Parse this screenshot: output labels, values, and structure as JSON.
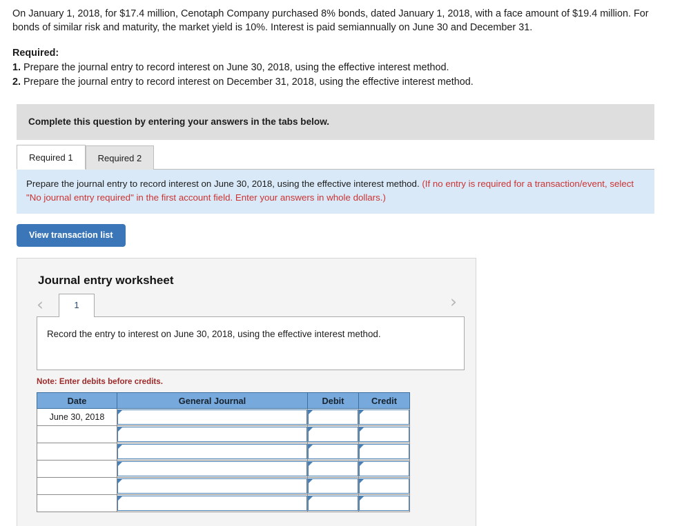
{
  "problem": {
    "text": "On January 1, 2018, for $17.4 million, Cenotaph Company purchased 8% bonds, dated January 1, 2018, with a face amount of $19.4 million. For bonds of similar risk and maturity, the market yield is 10%. Interest is paid semiannually on June 30 and December 31."
  },
  "required": {
    "title": "Required:",
    "items": [
      {
        "num": "1.",
        "text": "Prepare the journal entry to record interest on June 30, 2018, using the effective interest method."
      },
      {
        "num": "2.",
        "text": "Prepare the journal entry to record interest on December 31, 2018, using the effective interest method."
      }
    ]
  },
  "banner": {
    "text": "Complete this question by entering your answers in the tabs below."
  },
  "tabs": [
    {
      "label": "Required 1",
      "active": true
    },
    {
      "label": "Required 2",
      "active": false
    }
  ],
  "instruction": {
    "plain": "Prepare the journal entry to record interest on June 30, 2018, using the effective interest method.",
    "hint": "(If no entry is required for a transaction/event, select \"No journal entry required\" in the first account field. Enter your answers in whole dollars.)"
  },
  "toolbar": {
    "view_transaction_list_label": "View transaction list",
    "button_color": "#3a76b8"
  },
  "worksheet": {
    "title": "Journal entry worksheet",
    "pager": {
      "prev_icon": "chevron-left-icon",
      "next_icon": "chevron-right-icon",
      "pages": [
        "1"
      ],
      "active_page": "1"
    },
    "description": "Record the entry to interest on June 30, 2018, using the effective interest method.",
    "note": "Note: Enter debits before credits.",
    "table": {
      "header_color": "#78a9dd",
      "columns": [
        "Date",
        "General Journal",
        "Debit",
        "Credit"
      ],
      "rows": [
        {
          "date": "June 30, 2018",
          "general_journal": "",
          "debit": "",
          "credit": ""
        },
        {
          "date": "",
          "general_journal": "",
          "debit": "",
          "credit": ""
        },
        {
          "date": "",
          "general_journal": "",
          "debit": "",
          "credit": ""
        },
        {
          "date": "",
          "general_journal": "",
          "debit": "",
          "credit": ""
        },
        {
          "date": "",
          "general_journal": "",
          "debit": "",
          "credit": ""
        },
        {
          "date": "",
          "general_journal": "",
          "debit": "",
          "credit": ""
        }
      ]
    }
  }
}
